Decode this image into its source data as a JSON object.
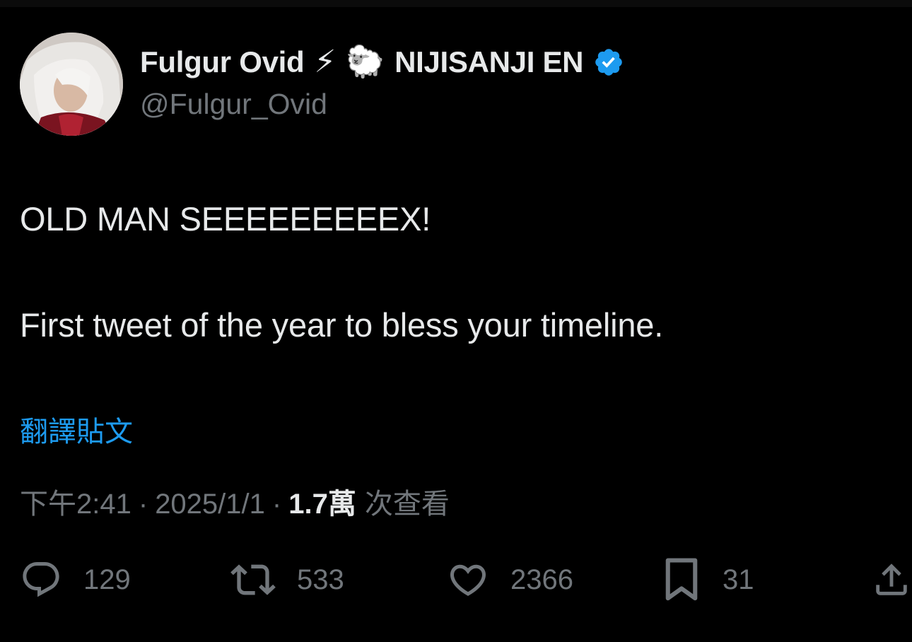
{
  "author": {
    "display_name": "Fulgur Ovid",
    "name_emoji_1": "⚡",
    "name_emoji_2": "🐑",
    "affiliation": "NIJISANJI EN",
    "handle": "@Fulgur_Ovid",
    "verified": true,
    "verified_color": "#1d9bf0"
  },
  "tweet": {
    "line1": "OLD MAN SEEEEEEEEEX!",
    "line2": "First tweet of the year to bless your timeline.",
    "translate_label": "翻譯貼文"
  },
  "meta": {
    "time": "下午2:41",
    "separator": "·",
    "date": "2025/1/1",
    "views_count": "1.7萬",
    "views_label": "次查看"
  },
  "actions": {
    "replies": "129",
    "retweets": "533",
    "likes": "2366",
    "bookmarks": "31"
  },
  "colors": {
    "background": "#000000",
    "text_primary": "#e7e9ea",
    "text_secondary": "#71767b",
    "accent": "#1d9bf0"
  },
  "icons": [
    "reply-icon",
    "retweet-icon",
    "like-icon",
    "bookmark-icon",
    "share-icon",
    "verified-badge-icon"
  ]
}
